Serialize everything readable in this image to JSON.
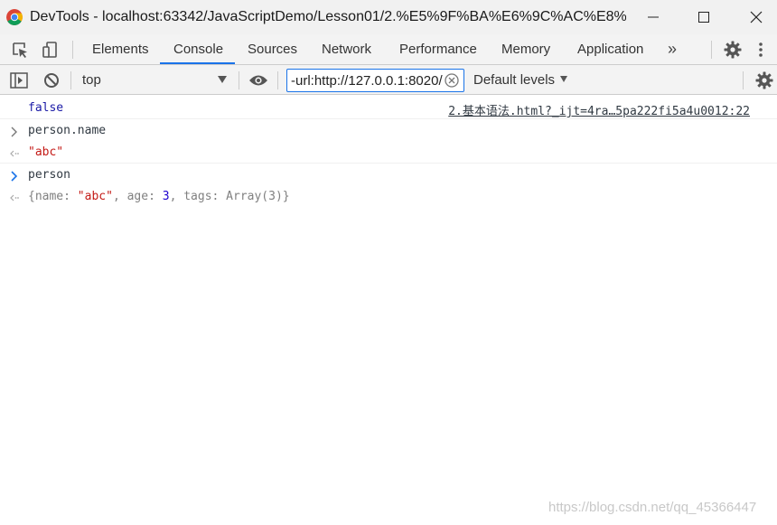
{
  "window": {
    "title": "DevTools - localhost:63342/JavaScriptDemo/Lesson01/2.%E5%9F%BA%E6%9C%AC%E8%...",
    "icon": "chrome-logo-icon",
    "controls": [
      "minimize-icon",
      "maximize-icon",
      "close-icon"
    ]
  },
  "tabs": {
    "items": [
      {
        "label": "Elements"
      },
      {
        "label": "Console"
      },
      {
        "label": "Sources"
      },
      {
        "label": "Network"
      },
      {
        "label": "Performance"
      },
      {
        "label": "Memory"
      },
      {
        "label": "Application"
      }
    ],
    "active": "Console",
    "overflow_label": "»",
    "accent_color": "#1a73e8"
  },
  "toolbar": {
    "context": "top",
    "filter_value": "-url:http://127.0.0.1:8020/",
    "levels_label": "Default levels"
  },
  "console": {
    "messages": [
      {
        "kind": "log",
        "text": "false",
        "source": "2.基本语法.html?_ijt=4ra…5pa222fi5a4u0012:22"
      },
      {
        "kind": "input",
        "text": "person.name"
      },
      {
        "kind": "result",
        "text": "\"abc\""
      },
      {
        "kind": "prompt",
        "text": "person"
      },
      {
        "kind": "result",
        "preview": {
          "open": "{",
          "k1": "name: ",
          "v1": "\"abc\"",
          "sep1": ", ",
          "k2": "age: ",
          "v2": "3",
          "sep2": ", ",
          "k3": "tags: Array(3)",
          "close": "}"
        }
      }
    ]
  },
  "watermark": "https://blog.csdn.net/qq_45366447",
  "colors": {
    "string": "#c41a16",
    "number": "#1c00cf",
    "boolean": "#1a1aa6",
    "prompt": "#1a73e8"
  }
}
